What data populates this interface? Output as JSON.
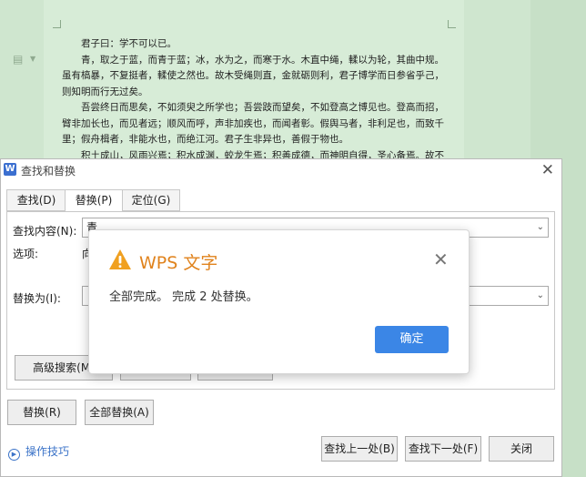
{
  "document": {
    "paragraphs": [
      {
        "text": "君子曰：学不可以已。",
        "indent": true
      },
      {
        "text": "青，取之于蓝，而青于蓝；冰，水为之，而寒于水。木直中绳，輮以为轮，其曲中规。",
        "indent": true
      },
      {
        "text": "虽有槁暴，不复挺者，輮使之然也。故木受绳则直，金就砺则利，君子博学而日参省乎己，",
        "indent": false
      },
      {
        "text": "则知明而行无过矣。",
        "indent": false
      },
      {
        "text": "吾尝终日而思矣，不如须臾之所学也；吾尝跂而望矣，不如登高之博见也。登高而招，",
        "indent": true
      },
      {
        "text": "臂非加长也，而见者远；顺风而呼，声非加疾也，而闻者彰。假舆马者，非利足也，而致千",
        "indent": false
      },
      {
        "text": "里；假舟楫者，非能水也，而绝江河。君子生非异也，善假于物也。",
        "indent": false
      },
      {
        "text": "积土成山，风雨兴焉；积水成渊，蛟龙生焉；积善成德，而神明自得，圣心备焉。故不",
        "indent": true
      }
    ]
  },
  "dialog": {
    "title": "查找和替换",
    "app_icon_letter": "W",
    "close_glyph": "✕",
    "tabs": {
      "find": "查找(D)",
      "replace": "替换(P)",
      "goto": "定位(G)"
    },
    "find_label": "查找内容(N):",
    "find_value": "青",
    "options_label": "选项:",
    "options_value": "向",
    "replace_label": "替换为(I):",
    "replace_value": "",
    "advanced_button": "高级搜索(M)",
    "replace_button": "替换(R)",
    "replace_all_button": "全部替换(A)",
    "tips_link": "操作技巧",
    "find_prev_button": "查找上一处(B)",
    "find_next_button": "查找下一处(F)",
    "close_button": "关闭",
    "dropdown_glyph": "⌄"
  },
  "message": {
    "title": "WPS 文字",
    "text": "全部完成。 完成 2 处替换。",
    "ok_button": "确定",
    "close_glyph": "✕",
    "warning_color": "#f0a020"
  }
}
